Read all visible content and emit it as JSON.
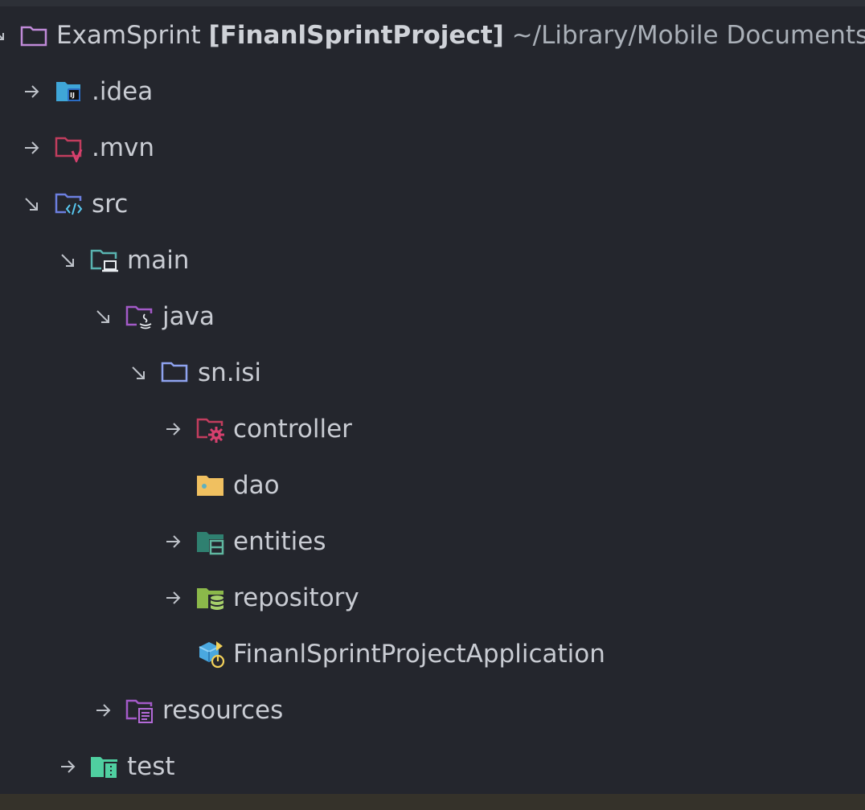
{
  "tree": {
    "root": {
      "name": "ExamSprint",
      "module": "[FinanlSprintProject]",
      "path": "~/Library/Mobile Documents/",
      "icon": "folder-icon"
    },
    "nodes": [
      {
        "label": ".idea",
        "icon": "intellij-folder-icon",
        "state": "collapsed"
      },
      {
        "label": ".mvn",
        "icon": "maven-folder-icon",
        "state": "collapsed"
      },
      {
        "label": "src",
        "icon": "source-folder-icon",
        "state": "expanded"
      },
      {
        "label": "main",
        "icon": "main-folder-icon",
        "state": "expanded"
      },
      {
        "label": "java",
        "icon": "java-folder-icon",
        "state": "expanded"
      },
      {
        "label": "sn.isi",
        "icon": "package-folder-icon",
        "state": "expanded"
      },
      {
        "label": "controller",
        "icon": "controller-folder-icon",
        "state": "collapsed"
      },
      {
        "label": "dao",
        "icon": "dao-folder-icon",
        "state": "leaf"
      },
      {
        "label": "entities",
        "icon": "entities-folder-icon",
        "state": "collapsed"
      },
      {
        "label": "repository",
        "icon": "repository-folder-icon",
        "state": "collapsed"
      },
      {
        "label": "FinanlSprintProjectApplication",
        "icon": "spring-application-icon",
        "state": "leaf"
      },
      {
        "label": "resources",
        "icon": "resources-folder-icon",
        "state": "collapsed"
      },
      {
        "label": "test",
        "icon": "test-folder-icon",
        "state": "collapsed"
      }
    ]
  },
  "colors": {
    "background": "#24262d",
    "text": "#c9ccd3",
    "root_folder": "#c08ad8",
    "idea": "#3fa6d8",
    "mvn": "#c23d5e",
    "src": "#6c7fe0",
    "main": "#59b3b0",
    "java": "#a35ac8",
    "package": "#8fa3f0",
    "controller": "#d6406e",
    "dao": "#f0c060",
    "entities": "#2f8070",
    "repository": "#8bb84a",
    "resources": "#a35ac8",
    "test": "#4fcfa0"
  }
}
